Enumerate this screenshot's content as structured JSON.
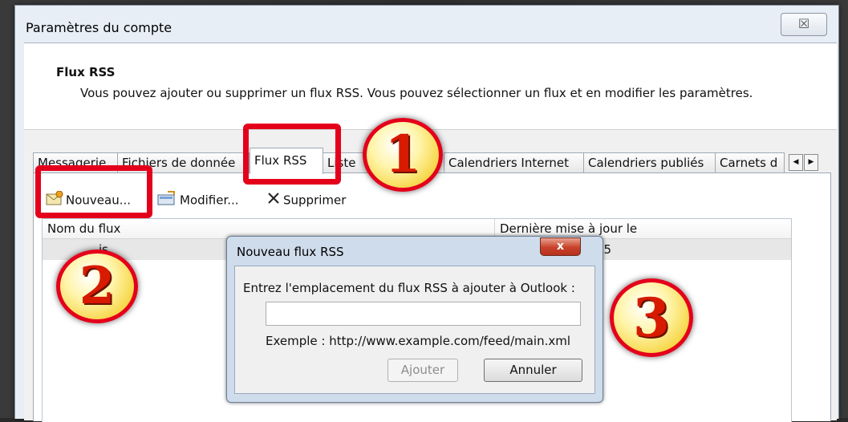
{
  "window": {
    "title": "Paramètres du compte",
    "close_label": "☒"
  },
  "header": {
    "title": "Flux RSS",
    "description": "Vous pouvez ajouter ou supprimer un flux RSS. Vous pouvez sélectionner un flux et en modifier les paramètres."
  },
  "tabs": [
    {
      "label": "Messagerie"
    },
    {
      "label": "Fichiers de donnée"
    },
    {
      "label": "Flux RSS",
      "active": true
    },
    {
      "label": "Liste"
    },
    {
      "label": "Calendriers Internet"
    },
    {
      "label": "Calendriers publiés"
    },
    {
      "label": "Carnets d"
    }
  ],
  "toolbar": {
    "new_label": "Nouveau...",
    "modify_label": "Modifier...",
    "delete_label": "Supprimer"
  },
  "list": {
    "columns": [
      "Nom du flux",
      "Dernière mise à jour le"
    ],
    "rows": [
      {
        "name": "is",
        "date": "05"
      }
    ]
  },
  "dialog": {
    "title": "Nouveau flux RSS",
    "close_label": "x",
    "prompt": "Entrez l'emplacement du flux RSS à ajouter à Outlook :",
    "input_value": "",
    "example": "Exemple : http://www.example.com/feed/main.xml",
    "add_label": "Ajouter",
    "cancel_label": "Annuler"
  },
  "callouts": {
    "one": "1",
    "two": "2",
    "three": "3"
  },
  "colors": {
    "callout_red": "#e4001b",
    "callout_gold": "#f5d23a"
  }
}
